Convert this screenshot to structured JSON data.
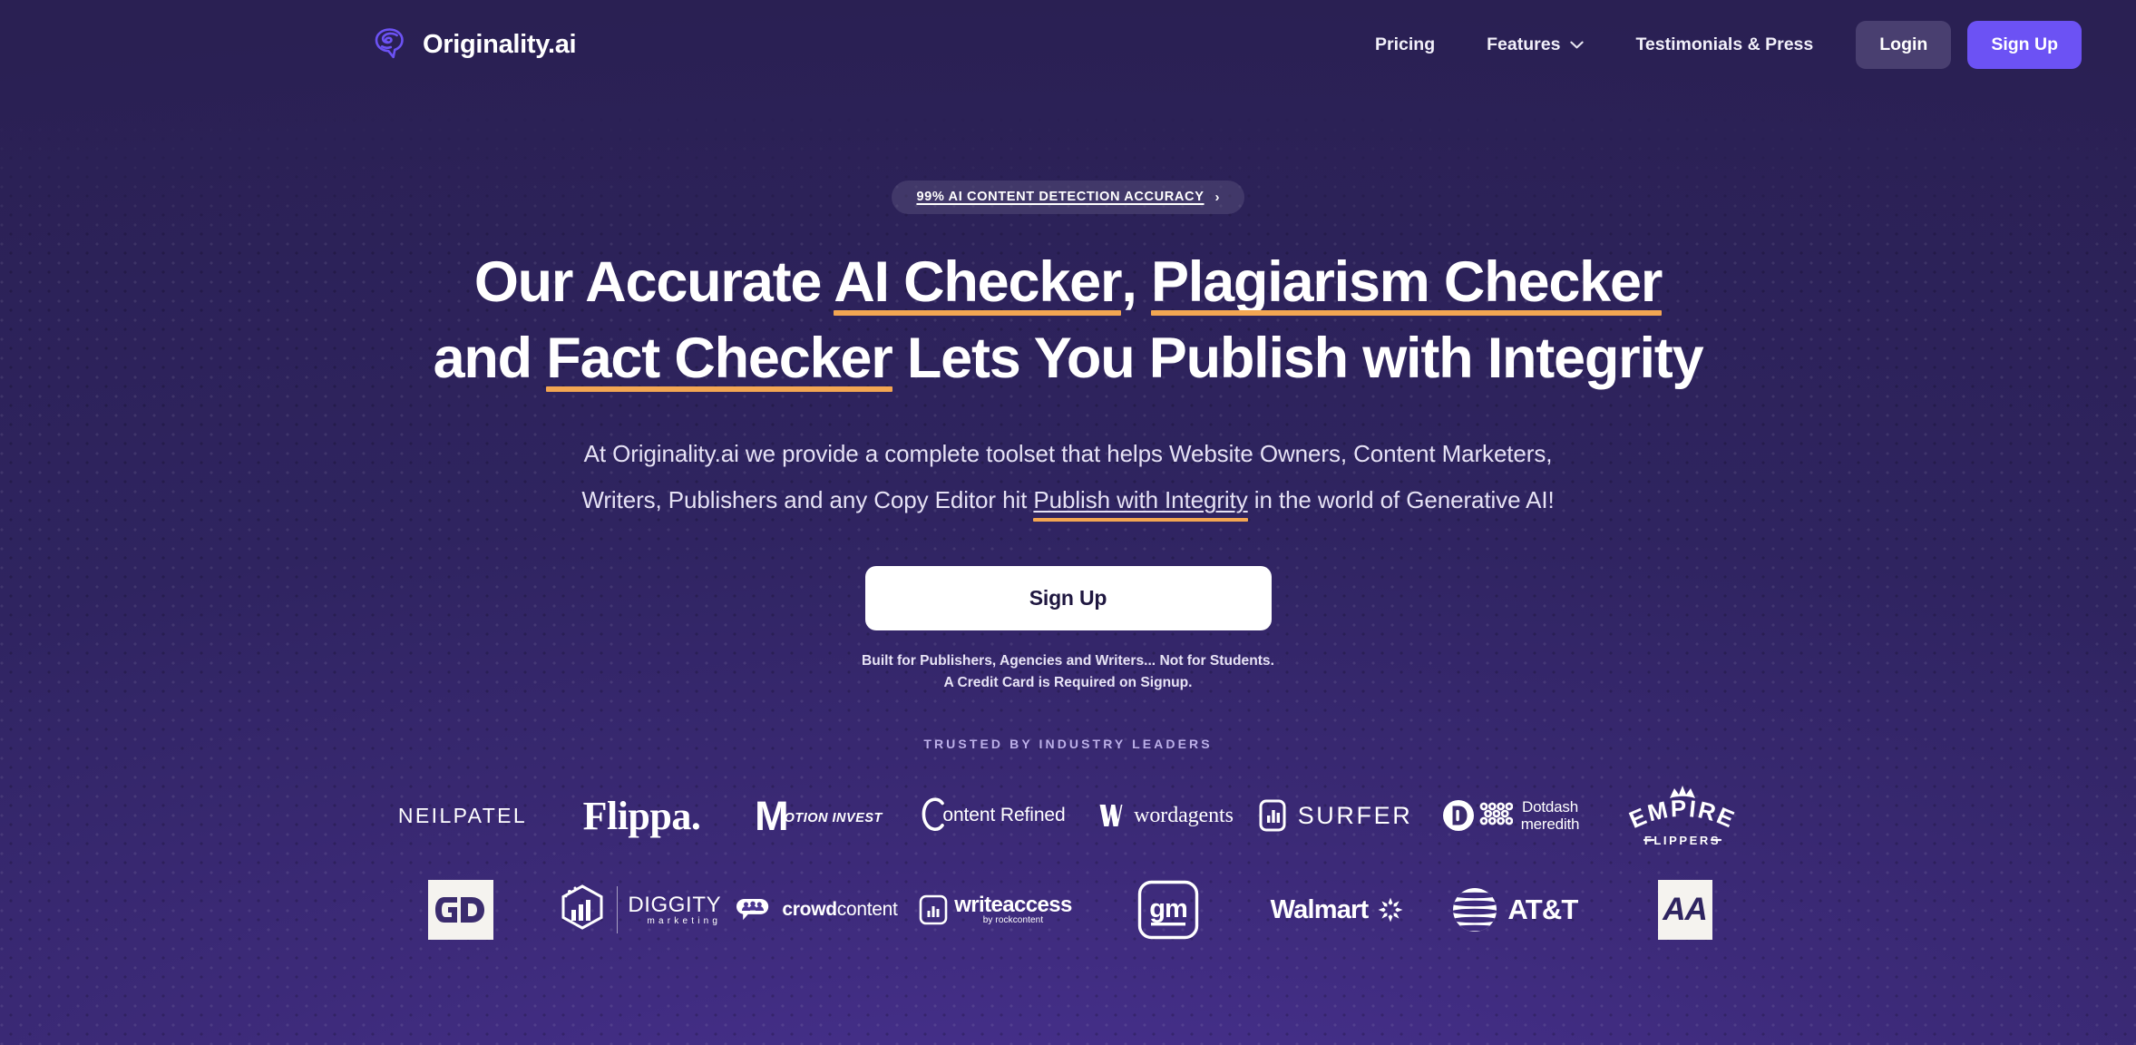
{
  "brand": {
    "name": "Originality.ai",
    "icon": "brain-icon"
  },
  "nav": {
    "links": [
      {
        "label": "Pricing",
        "icon": null
      },
      {
        "label": "Features",
        "icon": "chevron-down-icon"
      },
      {
        "label": "Testimonials & Press",
        "icon": null
      }
    ],
    "login_label": "Login",
    "signup_label": "Sign Up"
  },
  "hero": {
    "badge_text": "99% AI CONTENT DETECTION ACCURACY",
    "badge_arrow": "›",
    "heading": {
      "line1_a": "Our Accurate ",
      "line1_b": "AI Checker",
      "line1_c": ", ",
      "line1_d": "Plagiarism Checker",
      "line2_a": "and ",
      "line2_b": "Fact Checker",
      "line2_c": " Lets You Publish with Integrity"
    },
    "subtitle": {
      "line1": "At Originality.ai we provide a complete toolset that helps Website Owners, Content Marketers,",
      "line2_a": "Writers, Publishers and any Copy Editor hit ",
      "line2_b": "Publish with Integrity",
      "line2_c": " in the world of Generative AI!"
    },
    "cta_label": "Sign Up",
    "fineprint_line1": "Built for Publishers, Agencies and Writers... Not for Students.",
    "fineprint_line2": "A Credit Card is Required on Signup."
  },
  "trusted": {
    "label": "TRUSTED BY INDUSTRY LEADERS",
    "row1": [
      {
        "name": "NEILPATEL",
        "id": "neilpatel"
      },
      {
        "name": "Flippa.",
        "id": "flippa"
      },
      {
        "name": "MOTION INVEST",
        "id": "motion-invest",
        "mark": "M",
        "text": "OTION INVEST"
      },
      {
        "name": "Content Refined",
        "id": "content-refined",
        "text": "ontent Refined"
      },
      {
        "name": "wordagents",
        "id": "wordagents",
        "text": "wordagents"
      },
      {
        "name": "SURFER",
        "id": "surfer",
        "text": "SURFER"
      },
      {
        "name": "Dotdash meredith",
        "id": "dotdash-meredith",
        "text1": "Dotdash",
        "text2": "meredith"
      },
      {
        "name": "EMPIRE FLIPPERS",
        "id": "empire-flippers",
        "text1": "EMPIRE",
        "text2": "– FLIPPERS –"
      }
    ],
    "row2": [
      {
        "name": "GD",
        "id": "gd",
        "text": "GD"
      },
      {
        "name": "DIGGITY marketing",
        "id": "diggity",
        "text1": "DIGGITY",
        "text2": "marketing"
      },
      {
        "name": "crowd content",
        "id": "crowd-content",
        "text1": "crowd",
        "text2": "content"
      },
      {
        "name": "writeaccess by rockcontent",
        "id": "writeaccess",
        "text1": "writeaccess",
        "text2": "by rockcontent"
      },
      {
        "name": "gm",
        "id": "gm",
        "text": "gm"
      },
      {
        "name": "Walmart",
        "id": "walmart",
        "text": "Walmart"
      },
      {
        "name": "AT&T",
        "id": "att",
        "text": "AT&T"
      },
      {
        "name": "AA",
        "id": "aa",
        "text": "AA"
      }
    ]
  },
  "colors": {
    "bg_top": "#2a2053",
    "bg_bottom": "#4c3399",
    "accent_purple": "#6c52f4",
    "accent_orange": "#f3a652",
    "login_bg": "#493f70"
  }
}
